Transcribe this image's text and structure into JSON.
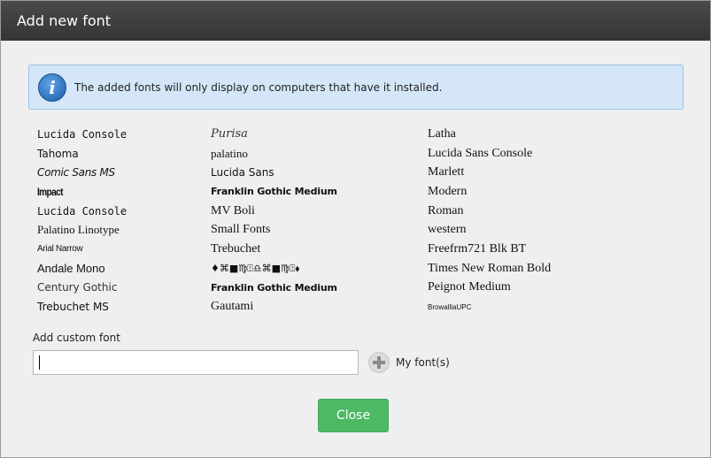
{
  "dialog": {
    "title": "Add new font",
    "info": {
      "icon": "info-icon",
      "message": "The added fonts will only display on computers that have it installed."
    },
    "fonts": {
      "col1": [
        "Lucida Console",
        "Tahoma",
        "Comic Sans MS",
        "Impact",
        "Lucida Console",
        "Palatino Linotype",
        "Arial Narrow",
        "Andale Mono",
        "Century Gothic",
        "Trebuchet MS"
      ],
      "col2": [
        "Purisa",
        "palatino",
        "Lucida Sans",
        "Franklin Gothic Medium",
        "MV Boli",
        "Small Fonts",
        "Trebuchet",
        "♦⌘■♍⍐♎⌘■♍⍐⬧",
        "Franklin Gothic Medium",
        "Gautami"
      ],
      "col3": [
        "Latha",
        "Lucida Sans Console",
        "Marlett",
        "Modern",
        "Roman",
        "western",
        "Freefrm721 Blk BT",
        "Times New Roman Bold",
        "Peignot Medium",
        "BrowalliaUPC"
      ]
    },
    "custom": {
      "label": "Add custom font",
      "value": "",
      "placeholder": "",
      "add_icon": "plus-icon",
      "my_fonts_label": "My font(s)"
    },
    "close_label": "Close",
    "colors": {
      "titlebar": "#3c3c3c",
      "info_bg": "#d4e6f8",
      "close_button": "#4cb965"
    }
  }
}
